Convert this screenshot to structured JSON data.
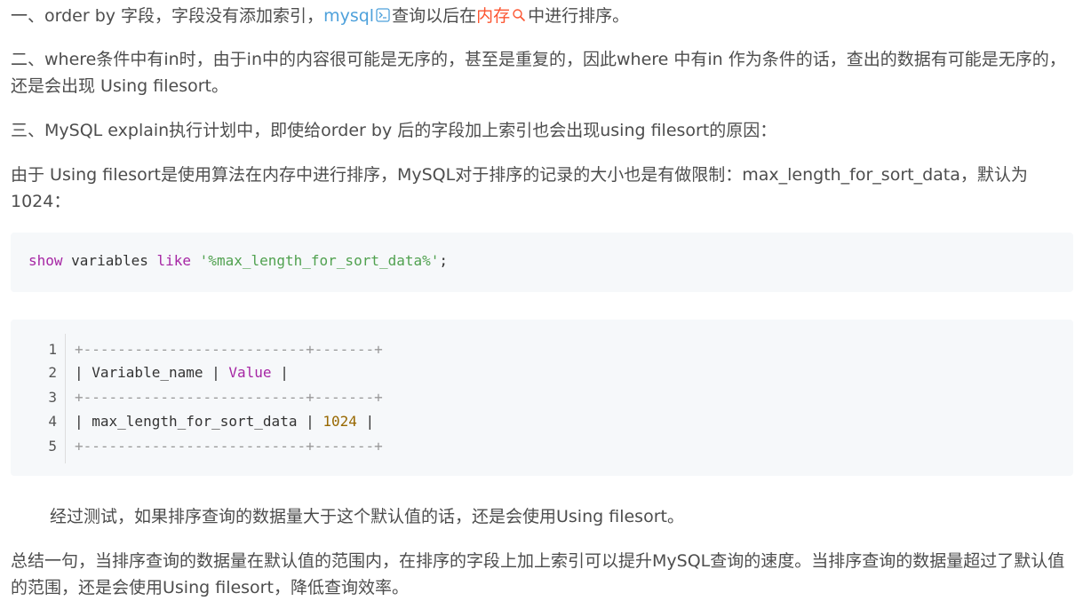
{
  "para1": {
    "before": "一、order by 字段，字段没有添加索引，",
    "link_mysql": "mysql",
    "middle": "查询以后在",
    "link_memory": "内存",
    "after": "中进行排序。"
  },
  "para2": "二、where条件中有in时，由于in中的内容很可能是无序的，甚至是重复的，因此where 中有in 作为条件的话，查出的数据有可能是无序的，还是会出现 Using filesort。",
  "para3": "三、MySQL explain执行计划中，即使给order by 后的字段加上索引也会出现using filesort的原因：",
  "para4": "由于 Using filesort是使用算法在内存中进行排序，MySQL对于排序的记录的大小也是有做限制：max_length_for_sort_data，默认为1024：",
  "code1": {
    "kw1": "show",
    "plain": " variables ",
    "kw2": "like",
    "space": " ",
    "str": "'%max_length_for_sort_data%'",
    "end": ";"
  },
  "code2": {
    "line_numbers": [
      "1",
      "2",
      "3",
      "4",
      "5"
    ],
    "border_line": "+--------------------------+-------+",
    "row1_a": "| Variable_name | ",
    "row1_kw": "Value",
    "row1_b": " |",
    "row2_a": "| max_length_for_sort_data | ",
    "row2_num": "1024",
    "row2_b": " |"
  },
  "para5": "经过测试，如果排序查询的数据量大于这个默认值的话，还是会使用Using filesort。",
  "para6": "总结一句，当排序查询的数据量在默认值的范围内，在排序的字段上加上索引可以提升MySQL查询的速度。当排序查询的数据量超过了默认值的范围，还是会使用Using filesort，降低查询效率。"
}
